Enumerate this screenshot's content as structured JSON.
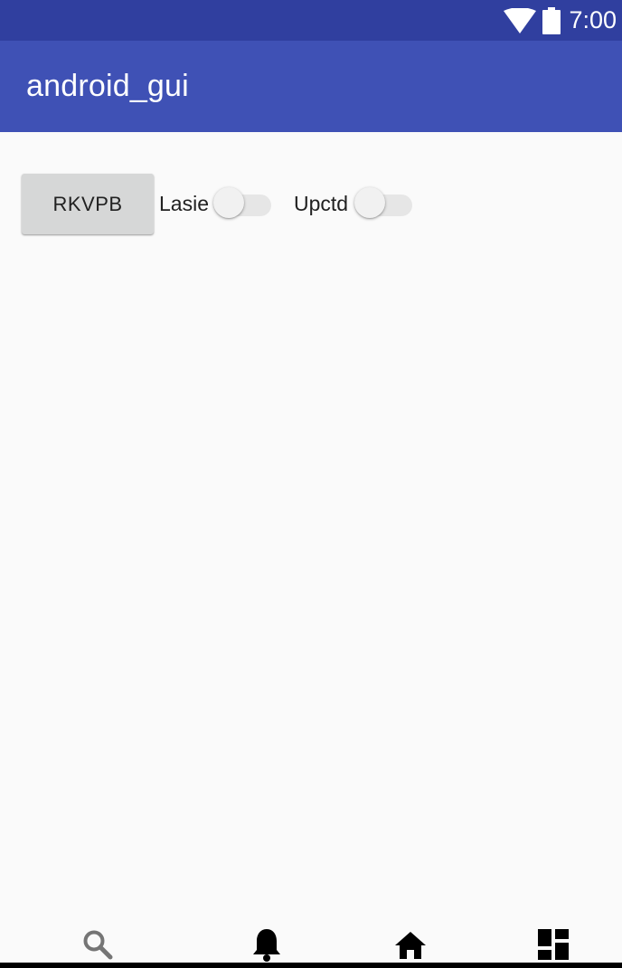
{
  "status_bar": {
    "time": "7:00",
    "icons": [
      "wifi-icon",
      "battery-icon"
    ],
    "background": "#303f9f"
  },
  "app_bar": {
    "title": "android_gui",
    "background": "#3f51b5"
  },
  "content": {
    "button_label": "RKVPB",
    "switches": [
      {
        "label": "Lasie",
        "checked": false
      },
      {
        "label": "Upctd",
        "checked": false
      }
    ]
  },
  "bottom_nav": {
    "items": [
      {
        "icon": "search-icon"
      },
      {
        "icon": "bell-icon"
      },
      {
        "icon": "home-icon"
      },
      {
        "icon": "dashboard-icon"
      }
    ]
  }
}
